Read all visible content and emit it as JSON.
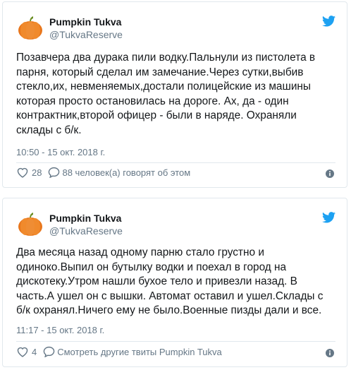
{
  "colors": {
    "twitter_blue": "#1da1f2",
    "text": "#14171a",
    "muted": "#657786",
    "border": "#e1e8ed",
    "avatar_orange": "#e8761c"
  },
  "tweets": [
    {
      "author": {
        "name": "Pumpkin Tukva",
        "handle": "@TukvaReserve",
        "avatar_icon": "pumpkin-avatar"
      },
      "text_lines": [
        "Позавчера два дурака пили водку.Пальнули из пистолета в",
        "парня, который сделал им замечание.Через сутки,выбив",
        "стекло,их, невменяемых,достали полицейские из машины",
        "которая просто остановилась на дороге. Ах, да - один",
        "контрактник,второй офицер - были в наряде. Охраняли",
        "склады с б/к."
      ],
      "timestamp": "10:50 - 15 окт. 2018 г.",
      "likes": "28",
      "reply_label": "88 человек(а) говорят об этом"
    },
    {
      "author": {
        "name": "Pumpkin Tukva",
        "handle": "@TukvaReserve",
        "avatar_icon": "pumpkin-avatar"
      },
      "text_lines": [
        "Два месяца назад одному парню стало грустно и",
        "одиноко.Выпил он бутылку водки и поехал в город на",
        "дискотеку.Утром нашли бухое тело и привезли назад. В",
        "часть.А ушел он с вышки. Автомат оставил и ушел.Склады с",
        "б/к охранял.Ничего ему не было.Военные пизды дали и все."
      ],
      "timestamp": "11:17 - 15 окт. 2018 г.",
      "likes": "4",
      "reply_label": "Смотреть другие твиты Pumpkin Tukva"
    }
  ]
}
